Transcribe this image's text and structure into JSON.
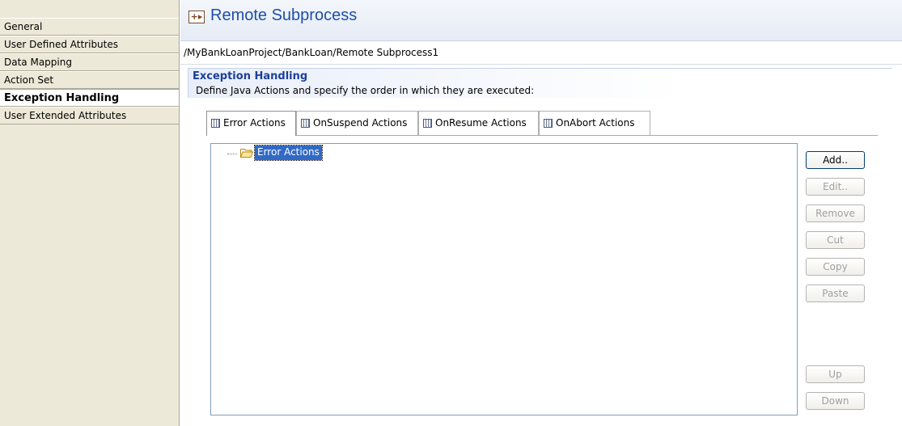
{
  "sidebar": {
    "items": [
      {
        "label": "General",
        "selected": false
      },
      {
        "label": "User Defined Attributes",
        "selected": false
      },
      {
        "label": "Data Mapping",
        "selected": false
      },
      {
        "label": "Action Set",
        "selected": false
      },
      {
        "label": "Exception Handling",
        "selected": true
      },
      {
        "label": "User Extended Attributes",
        "selected": false
      }
    ]
  },
  "header": {
    "icon": "subprocess-icon",
    "title": "Remote Subprocess",
    "breadcrumb": "/MyBankLoanProject/BankLoan/Remote Subprocess1"
  },
  "section": {
    "title": "Exception Handling",
    "description": "Define Java Actions and specify the order in which they are executed:"
  },
  "tabs": [
    {
      "label": "Error Actions",
      "icon": "actions-icon",
      "active": true
    },
    {
      "label": "OnSuspend Actions",
      "icon": "actions-icon",
      "active": false
    },
    {
      "label": "OnResume Actions",
      "icon": "actions-icon",
      "active": false
    },
    {
      "label": "OnAbort Actions",
      "icon": "actions-icon",
      "active": false
    }
  ],
  "tree": {
    "root": {
      "label": "Error Actions",
      "icon": "folder-open-icon",
      "selected": true
    }
  },
  "buttons": {
    "add": "Add..",
    "edit": "Edit..",
    "remove": "Remove",
    "cut": "Cut",
    "copy": "Copy",
    "paste": "Paste",
    "up": "Up",
    "down": "Down"
  },
  "colors": {
    "title": "#1e4ea8",
    "selection": "#316ac5",
    "sidebar_bg": "#ece9d8"
  }
}
